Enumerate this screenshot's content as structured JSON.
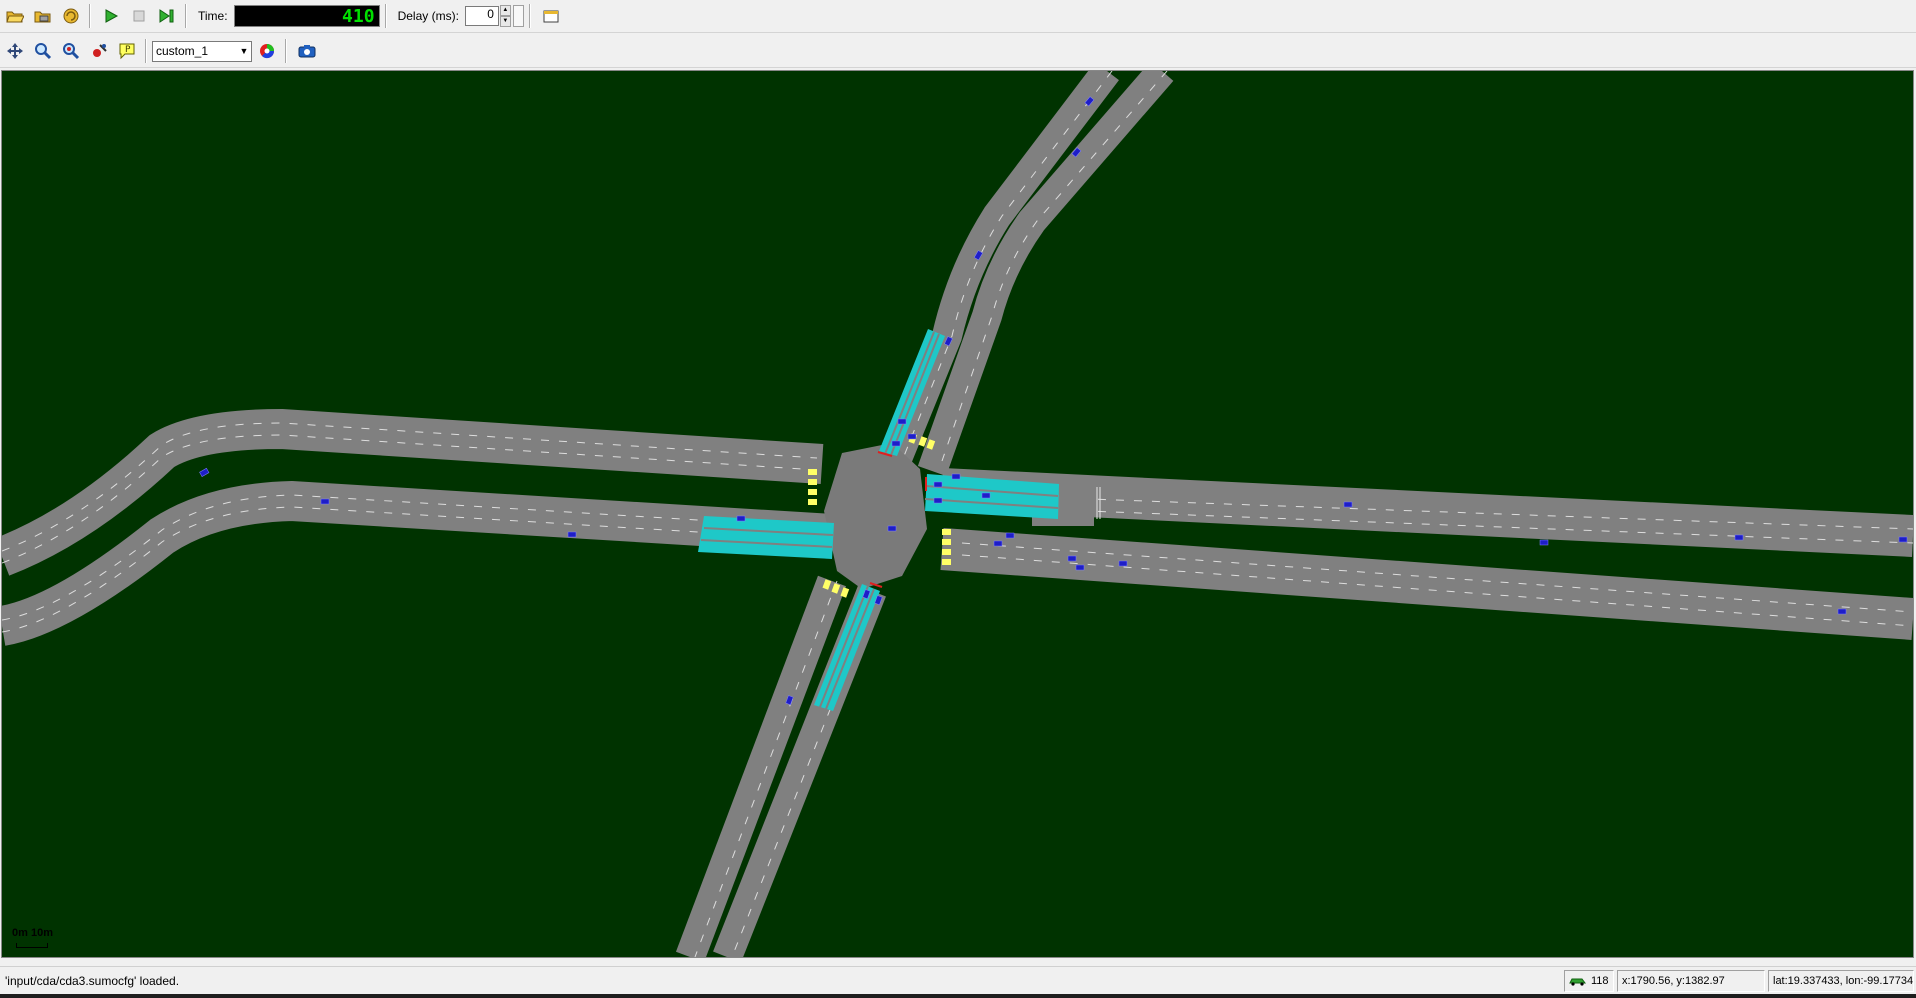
{
  "toolbar1": {
    "time_label": "Time:",
    "time_value": "410",
    "delay_label": "Delay (ms):",
    "delay_value": "0"
  },
  "toolbar2": {
    "color_scheme": "custom_1"
  },
  "canvas": {
    "background_color": "#003300",
    "road_color": "#808080",
    "detector_color": "#1ec8c8",
    "crossing_color": "#ffff66",
    "vehicle_color": "#1e1ec8",
    "scale_label": "0m 10m"
  },
  "status": {
    "message": "'input/cda/cda3.sumocfg' loaded.",
    "vehicle_count": "118",
    "xy_coords": "x:1790.56, y:1382.97",
    "latlon": "lat:19.337433, lon:-99.17734"
  }
}
